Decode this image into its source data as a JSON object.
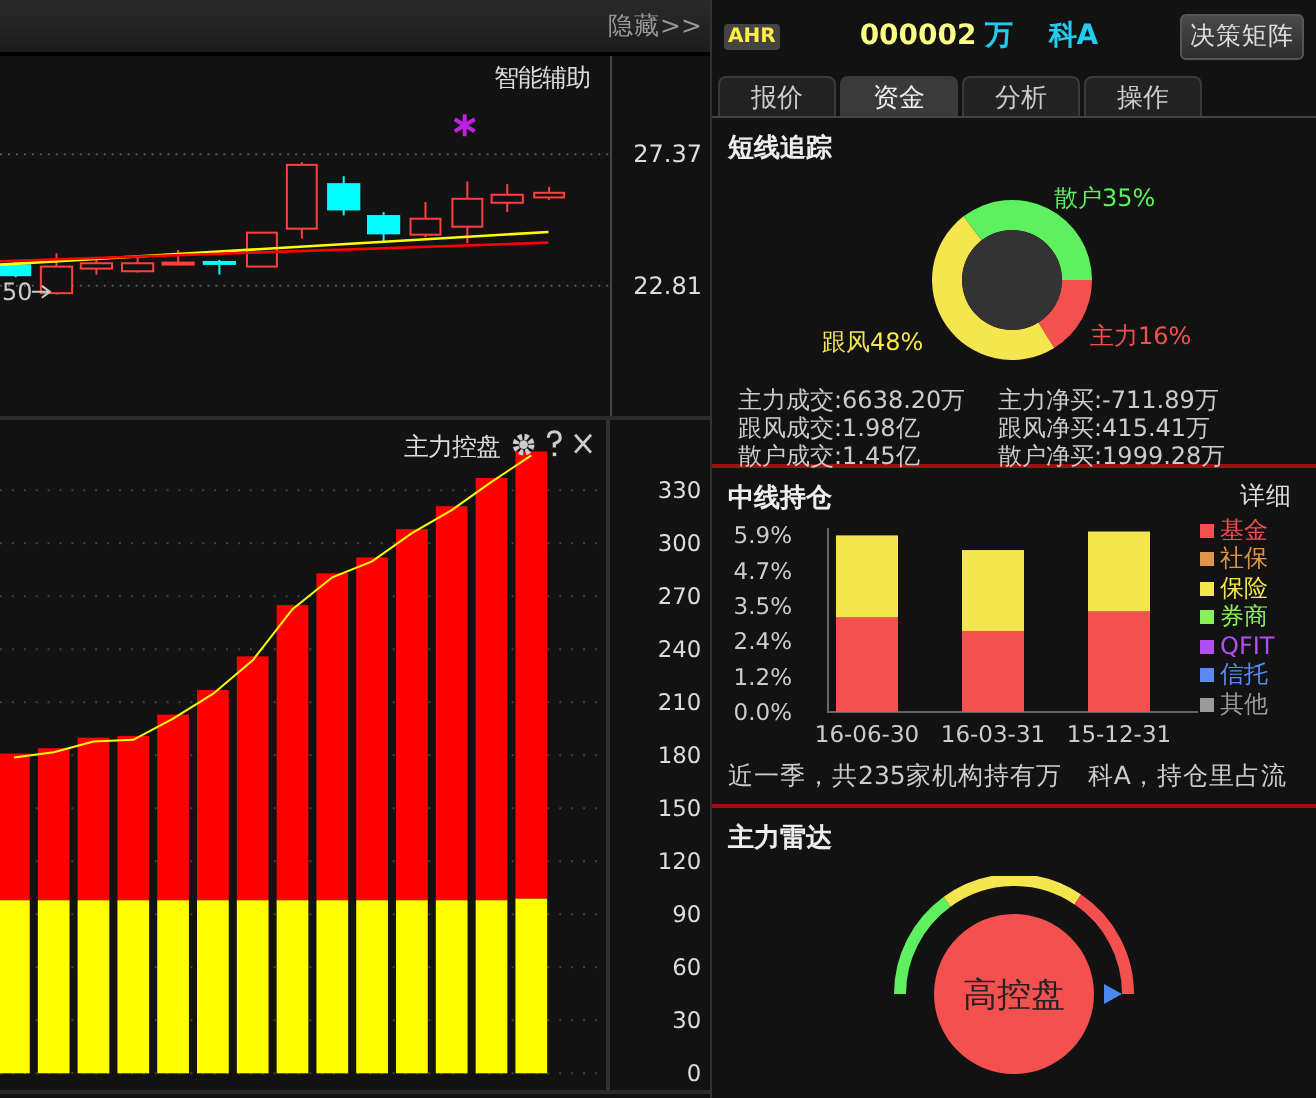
{
  "left": {
    "hide_label": "隐藏>>",
    "price_chart": {
      "title": "智能辅助",
      "side_label": "50",
      "price_labels": [
        "27.37",
        "22.81"
      ]
    },
    "control_chart": {
      "title": "主力控盘",
      "chart_data": {
        "type": "bar",
        "stacked": true,
        "grid": true,
        "ylim": [
          0,
          370
        ],
        "yticks": [
          {
            "value": 0,
            "label": "0"
          },
          {
            "value": 30,
            "label": "30"
          },
          {
            "value": 60,
            "label": "60"
          },
          {
            "value": 90,
            "label": "90"
          },
          {
            "value": 120,
            "label": "120"
          },
          {
            "value": 150,
            "label": "150"
          },
          {
            "value": 180,
            "label": "180"
          },
          {
            "value": 210,
            "label": "210"
          },
          {
            "value": 240,
            "label": "240"
          },
          {
            "value": 270,
            "label": "270"
          },
          {
            "value": 300,
            "label": "300"
          },
          {
            "value": 330,
            "label": "330"
          }
        ],
        "series": [
          {
            "color": "#ffff00",
            "values": [
              98,
              98,
              98,
              98,
              98,
              98,
              98,
              98,
              98,
              98,
              98,
              98,
              98,
              99
            ]
          },
          {
            "color": "#ff0000",
            "values": [
              83,
              86,
              92,
              93,
              105,
              119,
              138,
              167,
              185,
              194,
              210,
              223,
              239,
              253
            ]
          }
        ]
      }
    }
  },
  "right": {
    "stock": {
      "badge": "AHR",
      "code": "000002",
      "name_part1": "万",
      "name_part2": "科A"
    },
    "decision_button": "决策矩阵",
    "tabs": [
      {
        "label": "报价",
        "selected": false
      },
      {
        "label": "资金",
        "selected": true
      },
      {
        "label": "分析",
        "selected": false
      },
      {
        "label": "操作",
        "selected": false
      }
    ],
    "short_term": {
      "title": "短线追踪",
      "chart_data": {
        "type": "donut",
        "values": [
          16,
          48,
          35
        ],
        "colors": [
          "#f55050",
          "#f5e650",
          "#5ef05e"
        ]
      },
      "labels": [
        {
          "text": "散户35%",
          "color": "#5ef05e"
        },
        {
          "text": "主力16%",
          "color": "#f55050"
        },
        {
          "text": "跟风48%",
          "color": "#f5e650"
        }
      ],
      "stats": [
        "主力成交:6638.20万",
        "主力净买:-711.89万",
        "跟风成交:1.98亿",
        "跟风净买:415.41万",
        "散户成交:1.45亿",
        "散户净买:1999.28万"
      ]
    },
    "mid_term": {
      "title": "中线持仓",
      "detail_link": "详细",
      "chart_data": {
        "type": "bar",
        "stacked": true,
        "categories": [
          "16-06-30",
          "16-03-31",
          "15-12-31"
        ],
        "ylim": [
          0,
          6.1
        ],
        "yticks": [
          {
            "value": 0,
            "label": "0.0%"
          },
          {
            "value": 1.18,
            "label": "1.2%"
          },
          {
            "value": 2.36,
            "label": "2.4%"
          },
          {
            "value": 3.54,
            "label": "3.5%"
          },
          {
            "value": 4.72,
            "label": "4.7%"
          },
          {
            "value": 5.9,
            "label": "5.9%"
          }
        ],
        "series": [
          {
            "color": "#f55050",
            "values": [
              3.16,
              2.7,
              3.36
            ]
          },
          {
            "color": "#f5e650",
            "values": [
              2.74,
              2.71,
              2.67
            ]
          }
        ]
      },
      "legend": [
        {
          "label": "基金",
          "color": "#f55050"
        },
        {
          "label": "社保",
          "color": "#e0964a"
        },
        {
          "label": "保险",
          "color": "#f5e650"
        },
        {
          "label": "券商",
          "color": "#8af05a"
        },
        {
          "label": "QFIT",
          "color": "#b050f0"
        },
        {
          "label": "信托",
          "color": "#5a8af0"
        },
        {
          "label": "其他",
          "color": "#9a9a9a"
        }
      ],
      "summary": "近一季，共235家机构持有万　科A，持仓里占流"
    },
    "radar": {
      "title": "主力雷达",
      "state": "高控盘"
    }
  }
}
